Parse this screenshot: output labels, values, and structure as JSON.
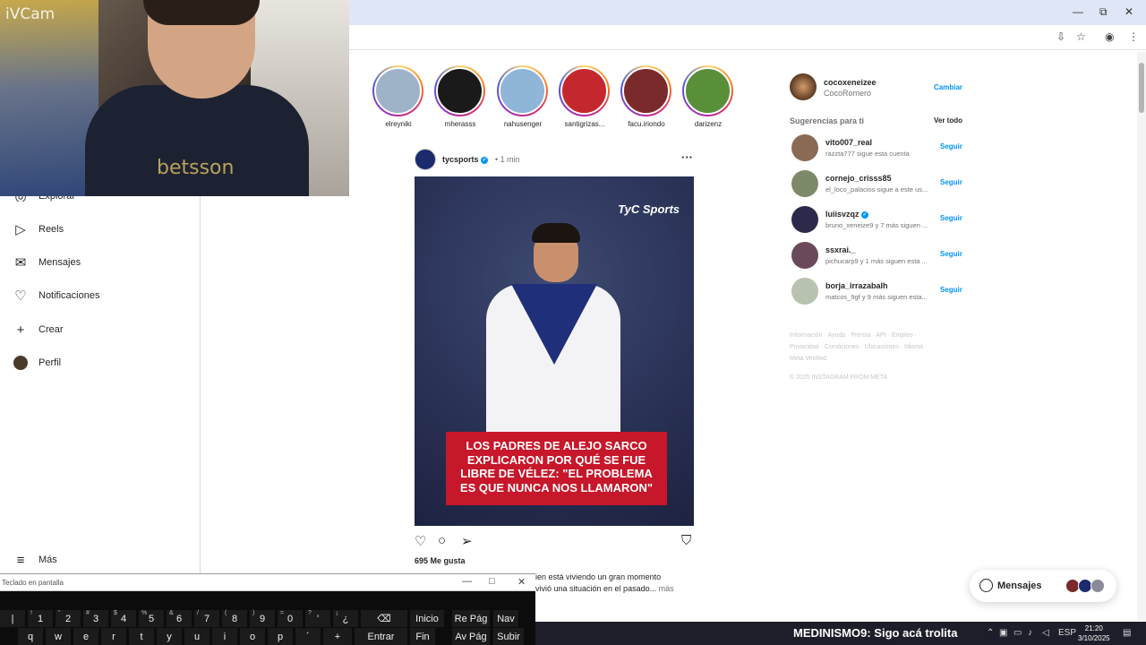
{
  "overlay": {
    "label": "iVCam",
    "shirt_text": "betsson"
  },
  "browser": {
    "controls": {
      "minimize": "—",
      "maximize": "⧉",
      "close": "✕"
    },
    "toolbar_icons": [
      "install-icon",
      "star-icon",
      "profile-icon",
      "menu-icon"
    ]
  },
  "sidebar": {
    "items": [
      {
        "label": "Explorar",
        "icon": "compass-icon"
      },
      {
        "label": "Reels",
        "icon": "reels-icon"
      },
      {
        "label": "Mensajes",
        "icon": "messenger-icon"
      },
      {
        "label": "Notificaciones",
        "icon": "heart-icon"
      },
      {
        "label": "Crear",
        "icon": "plus-icon"
      },
      {
        "label": "Perfil",
        "icon": "profile-avatar"
      }
    ],
    "more": "Más"
  },
  "stories": [
    {
      "name": "elreyniki",
      "color": "#9fb3c8"
    },
    {
      "name": "mherasss",
      "color": "#1a1a1a"
    },
    {
      "name": "nahusenger",
      "color": "#8fb5d9"
    },
    {
      "name": "santigrizas...",
      "color": "#c4282e"
    },
    {
      "name": "facu.iriondo",
      "color": "#7a2a2a"
    },
    {
      "name": "darizenz",
      "color": "#5a8f3a"
    }
  ],
  "post": {
    "username": "tycsports",
    "separator": "•",
    "time": "1 min",
    "brand": "TyC Sports",
    "headline": "LOS PADRES DE ALEJO SARCO EXPLICARON POR QUÉ SE FUE LIBRE DE VÉLEZ: \"EL PROBLEMA ES QUE NUNCA NOS LLAMARON\"",
    "likes": "695 Me gusta",
    "caption_line1": "ien está viviendo un gran momento",
    "caption_line2": "vivió una situación en el pasado...",
    "caption_more": "más"
  },
  "account": {
    "username": "cocoxeneizee",
    "name": "CocoRomero",
    "switch": "Cambiar"
  },
  "suggestions": {
    "title": "Sugerencias para ti",
    "see_all": "Ver todo",
    "follow": "Seguir",
    "items": [
      {
        "name": "vito007_real",
        "sub": "razzta777 sigue esta cuenta",
        "color": "#8a6a55"
      },
      {
        "name": "cornejo_crisss85",
        "sub": "el_loco_palacios sigue a este us...",
        "color": "#7d8a6a"
      },
      {
        "name": "luiisvzqz",
        "sub": "bruno_xeneize9 y 7 más siguen ...",
        "color": "#2b2a4a"
      },
      {
        "name": "ssxrai._",
        "sub": "pichucarp9 y 1 más siguen esta ...",
        "color": "#6a4a5a"
      },
      {
        "name": "borja_irrazabalh",
        "sub": "matcos_9gf y 9 más siguen esta...",
        "color": "#b8c2b0"
      }
    ]
  },
  "footer": {
    "links": "Información · Ayuda · Prensa · API · Empleo · Privacidad · Condiciones · Ubicaciones · Idioma · Meta Verified",
    "copyright": "© 2025 INSTAGRAM FROM META"
  },
  "messages_pill": {
    "label": "Mensajes",
    "avatar_colors": [
      "#7a2a2a",
      "#1c2a6e",
      "#8a8a9a"
    ]
  },
  "keyboard": {
    "title": "Teclado en pantalla",
    "row1": [
      {
        "k": "|",
        "s": ""
      },
      {
        "k": "1",
        "s": "!"
      },
      {
        "k": "2",
        "s": "\""
      },
      {
        "k": "3",
        "s": "#"
      },
      {
        "k": "4",
        "s": "$"
      },
      {
        "k": "5",
        "s": "%"
      },
      {
        "k": "6",
        "s": "&"
      },
      {
        "k": "7",
        "s": "/"
      },
      {
        "k": "8",
        "s": "("
      },
      {
        "k": "9",
        "s": ")"
      },
      {
        "k": "0",
        "s": "="
      },
      {
        "k": "'",
        "s": "?"
      },
      {
        "k": "¿",
        "s": "¡"
      },
      {
        "k": "⌫",
        "s": ""
      }
    ],
    "row2": [
      "q",
      "w",
      "e",
      "r",
      "t",
      "y",
      "u",
      "i",
      "o",
      "p",
      "´",
      "+",
      "Entrar"
    ],
    "nav": {
      "inicio": "Inicio",
      "repag": "Re Pág",
      "nav": "Nav",
      "fin": "Fin",
      "avpag": "Av Pág",
      "subir": "Subir"
    }
  },
  "taskbar": {
    "stream_user": "MEDINISMO9",
    "stream_text": ": Sigo acá trolita",
    "lang": "ESP",
    "time": "21:20",
    "date": "3/10/2025"
  }
}
